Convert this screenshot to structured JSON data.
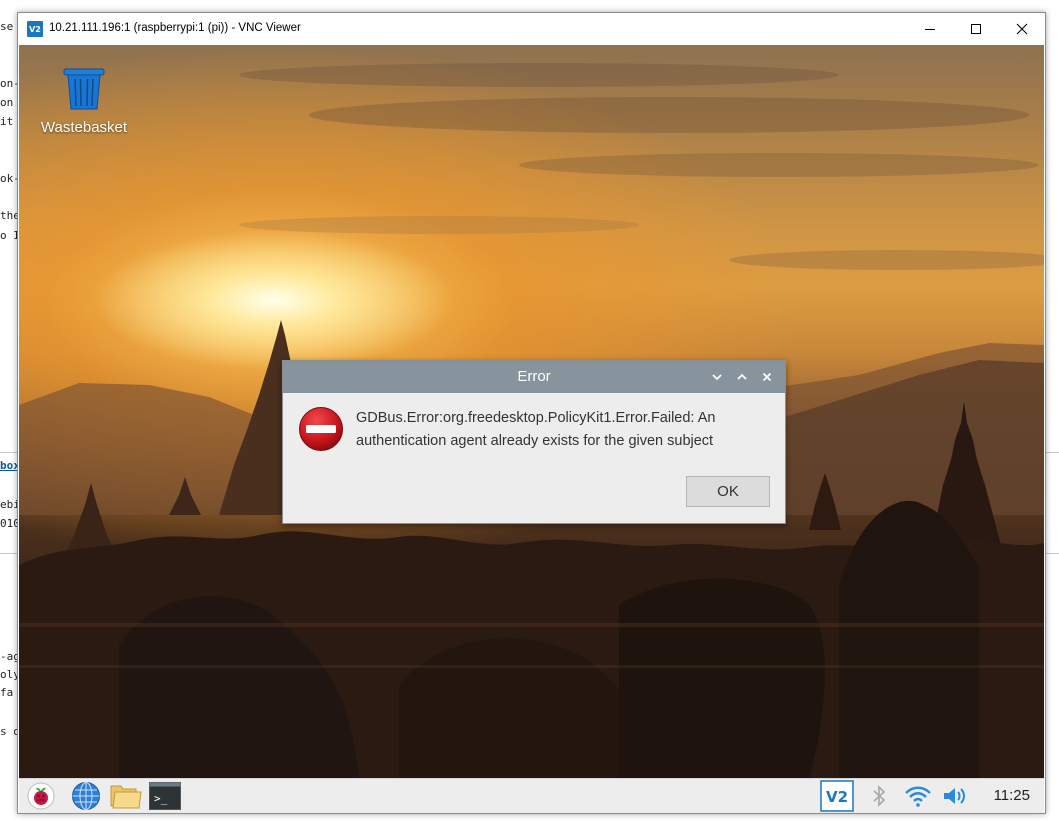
{
  "background_window": {
    "text_fragments": [
      {
        "text": "se s"
      },
      {
        "text": "on-("
      },
      {
        "text": "on"
      },
      {
        "text": "it "
      },
      {
        "text": "ok-p"
      },
      {
        "text": "the"
      },
      {
        "text": "o I"
      },
      {
        "text": "box"
      },
      {
        "text": "ebi"
      },
      {
        "text": "010"
      },
      {
        "text": "-age"
      },
      {
        "text": "oly"
      },
      {
        "text": " fa"
      },
      {
        "text": "s o"
      }
    ]
  },
  "vnc_window": {
    "title": "10.21.111.196:1 (raspberrypi:1 (pi)) - VNC Viewer",
    "app_icon_text": "V2"
  },
  "desktop": {
    "wastebasket_label": "Wastebasket"
  },
  "dialog": {
    "title": "Error",
    "message": "GDBus.Error:org.freedesktop.PolicyKit1.Error.Failed: An authentication agent already exists for the given subject",
    "ok_label": "OK",
    "accent_title_bg": "#87939d",
    "error_icon_color": "#d01f27"
  },
  "taskbar": {
    "clock": "11:25",
    "vnc_tray_text": "V2"
  }
}
